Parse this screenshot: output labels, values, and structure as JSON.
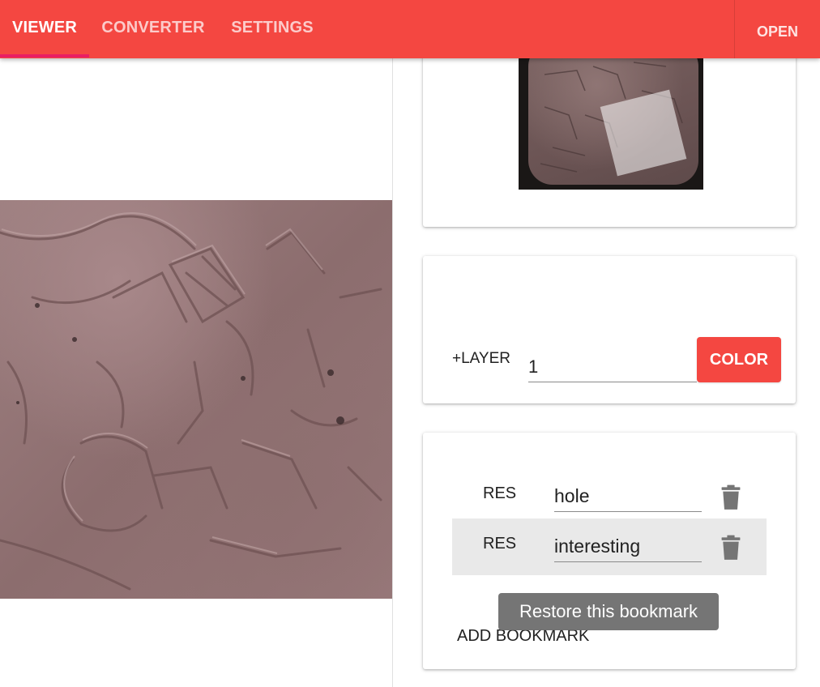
{
  "appbar": {
    "tabs": [
      {
        "label": "VIEWER",
        "active": true
      },
      {
        "label": "CONVERTER",
        "active": false
      },
      {
        "label": "SETTINGS",
        "active": false
      }
    ],
    "open_label": "OPEN",
    "accent_color": "#f44741",
    "indicator_color": "#e91e63"
  },
  "viewer": {
    "icon": "tablet-image"
  },
  "minimap": {
    "icon": "tablet-thumbnail"
  },
  "layer_panel": {
    "add_layer_label": "+LAYER",
    "layer_value": "1",
    "color_button_label": "COLOR"
  },
  "bookmarks": {
    "items": [
      {
        "res_label": "RES",
        "name": "hole",
        "delete_icon": "trash-icon"
      },
      {
        "res_label": "RES",
        "name": "interesting",
        "delete_icon": "trash-icon"
      }
    ],
    "add_label": "ADD BOOKMARK",
    "tooltip": "Restore this bookmark"
  }
}
